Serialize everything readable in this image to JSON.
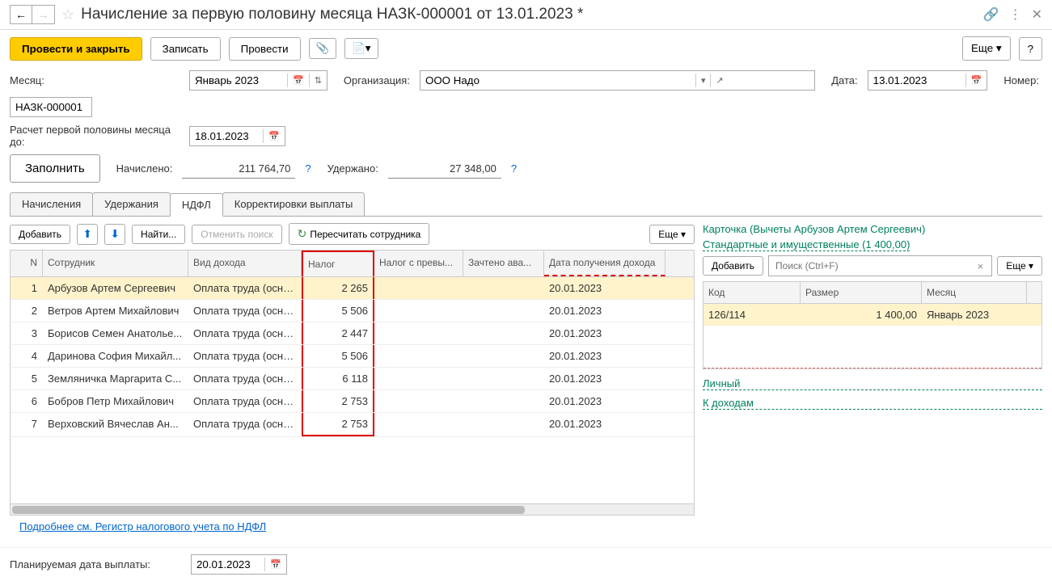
{
  "title": "Начисление за первую половину месяца НАЗК-000001 от 13.01.2023 *",
  "toolbar": {
    "post_close": "Провести и закрыть",
    "write": "Записать",
    "post": "Провести",
    "more": "Еще",
    "help": "?"
  },
  "form": {
    "month_label": "Месяц:",
    "month_value": "Январь 2023",
    "org_label": "Организация:",
    "org_value": "ООО Надо",
    "date_label": "Дата:",
    "date_value": "13.01.2023",
    "number_label": "Номер:",
    "number_value": "НАЗК-000001",
    "calc_until_label": "Расчет первой половины месяца до:",
    "calc_until_value": "18.01.2023",
    "fill_btn": "Заполнить",
    "accrued_label": "Начислено:",
    "accrued_value": "211 764,70",
    "withheld_label": "Удержано:",
    "withheld_value": "27 348,00"
  },
  "tabs": {
    "accruals": "Начисления",
    "withholdings": "Удержания",
    "ndfl": "НДФЛ",
    "corrections": "Корректировки выплаты"
  },
  "grid_toolbar": {
    "add": "Добавить",
    "find": "Найти...",
    "cancel_search": "Отменить поиск",
    "recalc": "Пересчитать сотрудника",
    "more": "Еще"
  },
  "grid": {
    "headers": {
      "n": "N",
      "emp": "Сотрудник",
      "type": "Вид дохода",
      "tax": "Налог",
      "exc": "Налог с превы...",
      "adv": "Зачтено ава...",
      "date": "Дата получения дохода"
    },
    "rows": [
      {
        "n": "1",
        "emp": "Арбузов Артем Сергеевич",
        "type": "Оплата труда (осно...",
        "tax": "2 265",
        "date": "20.01.2023"
      },
      {
        "n": "2",
        "emp": "Ветров Артем Михайлович",
        "type": "Оплата труда (осно...",
        "tax": "5 506",
        "date": "20.01.2023"
      },
      {
        "n": "3",
        "emp": "Борисов Семен Анатолье...",
        "type": "Оплата труда (осно...",
        "tax": "2 447",
        "date": "20.01.2023"
      },
      {
        "n": "4",
        "emp": "Даринова София Михайл...",
        "type": "Оплата труда (осно...",
        "tax": "5 506",
        "date": "20.01.2023"
      },
      {
        "n": "5",
        "emp": "Земляничка Маргарита С...",
        "type": "Оплата труда (осно...",
        "tax": "6 118",
        "date": "20.01.2023"
      },
      {
        "n": "6",
        "emp": "Бобров Петр Михайлович",
        "type": "Оплата труда (осно...",
        "tax": "2 753",
        "date": "20.01.2023"
      },
      {
        "n": "7",
        "emp": "Верховский Вячеслав Ан...",
        "type": "Оплата труда (осно...",
        "tax": "2 753",
        "date": "20.01.2023"
      }
    ]
  },
  "right": {
    "card_label": "Карточка (Вычеты Арбузов Артем Сергеевич)",
    "deductions_link": "Стандартные и имущественные (1 400,00)",
    "add": "Добавить",
    "search_placeholder": "Поиск (Ctrl+F)",
    "more": "Еще",
    "headers": {
      "code": "Код",
      "size": "Размер",
      "month": "Месяц"
    },
    "rows": [
      {
        "code": "126/114",
        "size": "1 400,00",
        "month": "Январь 2023"
      }
    ],
    "personal_link": "Личный",
    "income_link": "К доходам"
  },
  "footer": {
    "register_link": "Подробнее см. Регистр налогового учета по НДФЛ",
    "planned_date_label": "Планируемая дата выплаты:",
    "planned_date_value": "20.01.2023"
  }
}
